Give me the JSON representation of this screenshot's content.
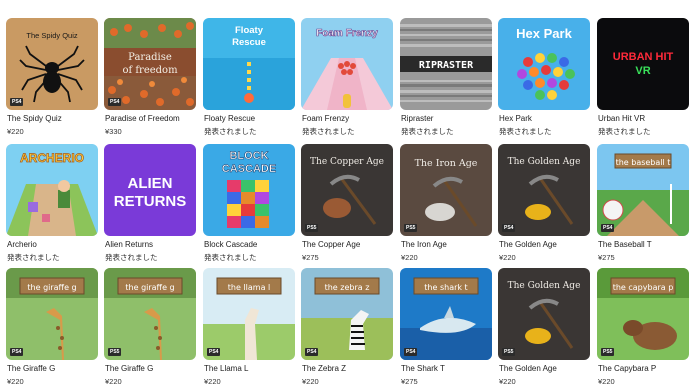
{
  "tiles": [
    {
      "title": "The Spidy Quiz",
      "price": "¥220",
      "art": "The Spidy Quiz",
      "badge": "PS4"
    },
    {
      "title": "Paradise of Freedom",
      "price": "¥330",
      "art": "Paradise of freedom",
      "badge": "PS4"
    },
    {
      "title": "Floaty Rescue",
      "price": "発表されました",
      "art": "Floaty Rescue",
      "badge": ""
    },
    {
      "title": "Foam Frenzy",
      "price": "発表されました",
      "art": "Foam Frenzy",
      "badge": ""
    },
    {
      "title": "Ripraster",
      "price": "発表されました",
      "art": "RIPRASTER",
      "badge": ""
    },
    {
      "title": "Hex Park",
      "price": "発表されました",
      "art": "Hex Park",
      "badge": ""
    },
    {
      "title": "Urban Hit VR",
      "price": "発表されました",
      "art": "URBAN HIT VR",
      "badge": ""
    },
    {
      "title": "Archerio",
      "price": "発表されました",
      "art": "ARCHERIO",
      "badge": ""
    },
    {
      "title": "Alien Returns",
      "price": "発表されました",
      "art": "ALIEN RETURNS",
      "badge": ""
    },
    {
      "title": "Block Cascade",
      "price": "発表されました",
      "art": "BLOCK CASCADE",
      "badge": ""
    },
    {
      "title": "The Copper Age",
      "price": "¥275",
      "art": "The Copper Age",
      "badge": "PS5"
    },
    {
      "title": "The Iron Age",
      "price": "¥220",
      "art": "The Iron Age",
      "badge": "PS5"
    },
    {
      "title": "The Golden Age",
      "price": "¥220",
      "art": "The Golden Age",
      "badge": "PS4"
    },
    {
      "title": "The Baseball T",
      "price": "¥275",
      "art": "the baseball t",
      "badge": "PS4"
    },
    {
      "title": "The Giraffe G",
      "price": "¥220",
      "art": "the giraffe g",
      "badge": "PS4"
    },
    {
      "title": "The Giraffe G",
      "price": "¥220",
      "art": "the giraffe g",
      "badge": "PS5"
    },
    {
      "title": "The Llama L",
      "price": "¥220",
      "art": "the llama l",
      "badge": "PS4"
    },
    {
      "title": "The Zebra Z",
      "price": "¥220",
      "art": "the zebra z",
      "badge": "PS4"
    },
    {
      "title": "The Shark T",
      "price": "¥275",
      "art": "the shark t",
      "badge": "PS4"
    },
    {
      "title": "The Golden Age",
      "price": "¥220",
      "art": "The Golden Age",
      "badge": "PS5"
    },
    {
      "title": "The Capybara P",
      "price": "¥220",
      "art": "the capybara p",
      "badge": "PS5"
    }
  ]
}
